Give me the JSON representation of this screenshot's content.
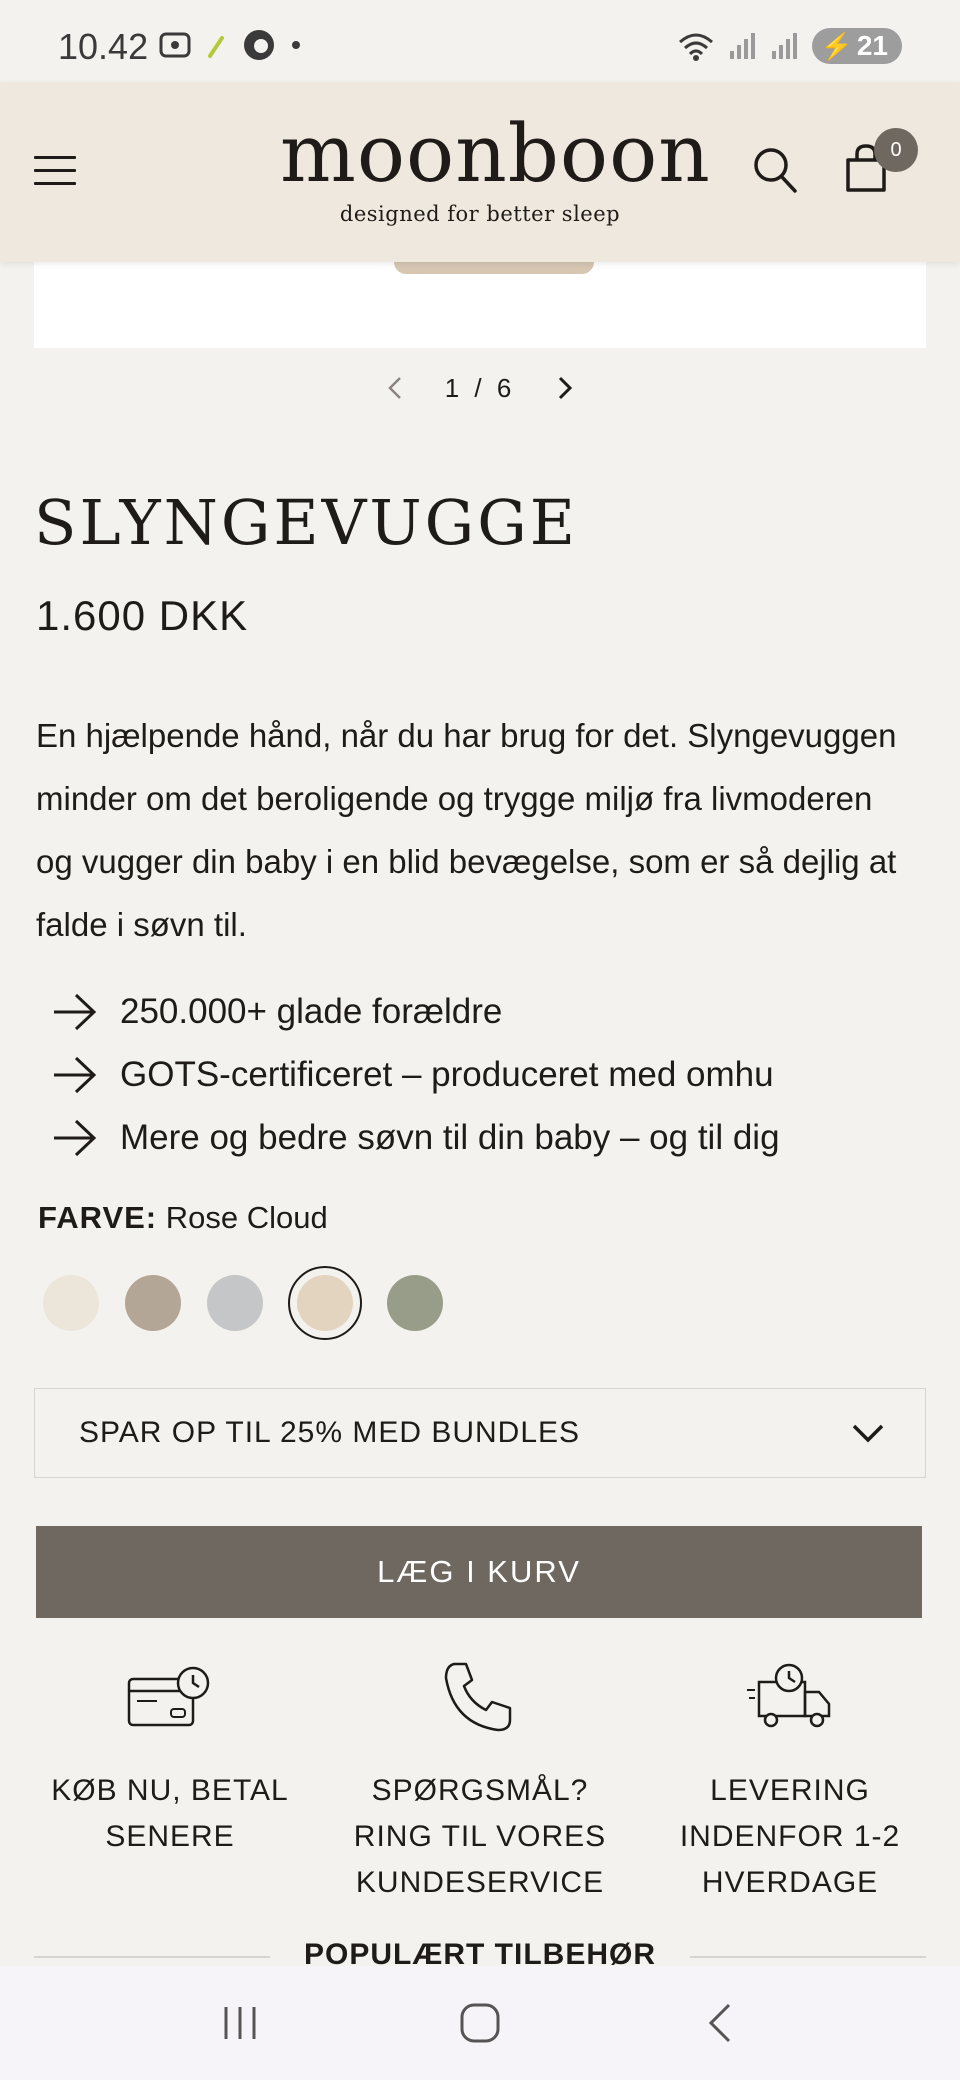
{
  "status_bar": {
    "time": "10.42",
    "battery": "21"
  },
  "header": {
    "logo": "moonboon",
    "tagline": "designed for better sleep",
    "cart_count": "0"
  },
  "gallery": {
    "counter": "1 / 6"
  },
  "product": {
    "title": "SLYNGEVUGGE",
    "price": "1.600 DKK",
    "description": "En hjælpende hånd, når du har brug for det. Slyngevuggen minder om det beroligende og trygge miljø fra livmoderen og vugger din baby i en blid bevægelse, som er så dejlig at falde i søvn til.",
    "usps": [
      "250.000+ glade forældre",
      "GOTS-certificeret – produceret med omhu",
      "Mere og bedre søvn til din baby – og til dig"
    ]
  },
  "color": {
    "label": "FARVE:",
    "selected_name": "Rose Cloud",
    "swatches": [
      {
        "color": "#ebe5da",
        "selected": false
      },
      {
        "color": "#b3a696",
        "selected": false
      },
      {
        "color": "#c5c6c8",
        "selected": false
      },
      {
        "color": "#e3d4bf",
        "selected": true
      },
      {
        "color": "#989d89",
        "selected": false
      }
    ]
  },
  "bundles": {
    "label": "SPAR OP TIL 25% MED BUNDLES"
  },
  "cart_button": {
    "label": "LÆG I KURV"
  },
  "features": [
    {
      "icon": "credit-card-clock-icon",
      "text": "KØB NU, BETAL\nSENERE"
    },
    {
      "icon": "phone-icon",
      "text": "SPØRGSMÅL?\nRING TIL VORES\nKUNDESERVICE"
    },
    {
      "icon": "delivery-truck-icon",
      "text": "LEVERING\nINDENFOR 1-2\nHVERDAGE"
    }
  ],
  "popular": {
    "heading": "POPULÆRT TILBEHØR"
  },
  "colors": {
    "accent": "#6f6860",
    "header_bg": "#efe8de",
    "page_bg": "#f4f2ef"
  }
}
